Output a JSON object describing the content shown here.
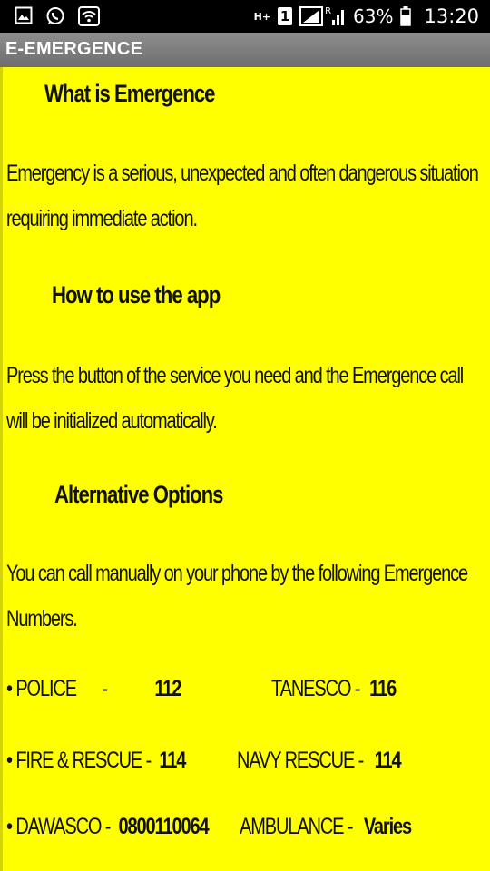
{
  "status_bar": {
    "icons_left": [
      "gallery-icon",
      "whatsapp-icon",
      "wifi-icon"
    ],
    "network_label": "H+",
    "sim_label": "1",
    "roaming_label": "R",
    "battery": "63%",
    "time": "13:20"
  },
  "app": {
    "title": "E-EMERGENCE"
  },
  "sections": {
    "what": {
      "heading": "What is Emergence",
      "text": "Emergency is a serious, unexpected and often dangerous situation requiring immediate action."
    },
    "how": {
      "heading": "How to use the app",
      "text": "Press the button of the service you need and the Emergence call will be initialized automatically."
    },
    "alt": {
      "heading": "Alternative Options",
      "text": "You can call manually  on your phone by the following Emergence Numbers."
    }
  },
  "numbers": {
    "police": {
      "label": "• POLICE",
      "sep": "-",
      "number": "112"
    },
    "tanesco": {
      "label": "TANESCO -",
      "number": "116"
    },
    "fire": {
      "label": "• FIRE & RESCUE -",
      "number": "114"
    },
    "navy": {
      "label": "NAVY RESCUE  -",
      "number": "114"
    },
    "dawasco": {
      "label": "• DAWASCO -",
      "number": "0800110064"
    },
    "ambulance": {
      "label": "AMBULANCE -",
      "number": "Varies"
    }
  },
  "colors": {
    "background": "#ffff00",
    "titlebar": "#7e7e7e",
    "statusbar": "#000000",
    "text": "#111111"
  }
}
